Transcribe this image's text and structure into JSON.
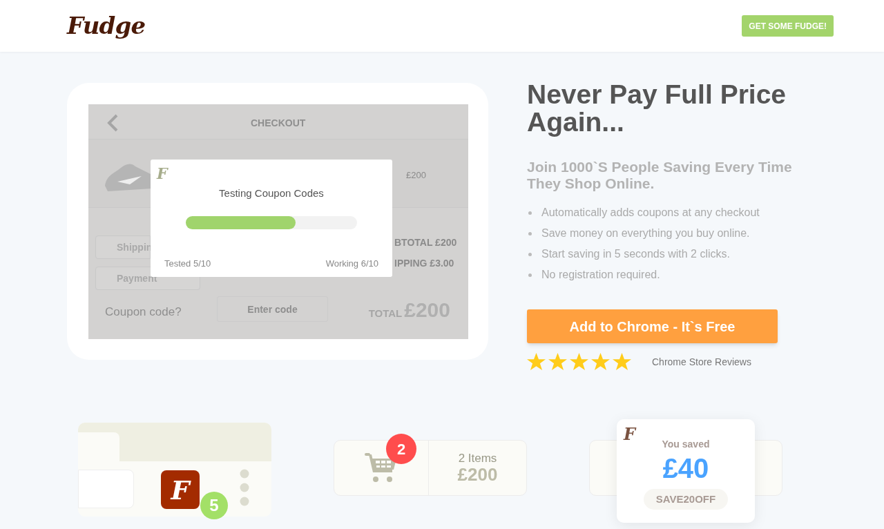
{
  "header": {
    "logo": "Fudge",
    "cta": "GET SOME FUDGE!"
  },
  "checkout_mockup": {
    "title": "CHECKOUT",
    "item_price": "£200",
    "shipping_select": "Shippin",
    "payment_select": "Payment",
    "subtotal": "BTOTAL £200",
    "shipping": "IPPING £3.00",
    "coupon_label": "Coupon code?",
    "coupon_placeholder": "Enter code",
    "total_label": "TOTAL",
    "total_value": "£200",
    "modal": {
      "logo": "F",
      "title": "Testing Coupon Codes",
      "level": 0.64,
      "tested": "Tested 5/10",
      "working": "Working 6/10"
    }
  },
  "hero": {
    "title": "Never Pay Full Price Again...",
    "subtitle": "Join 1000`S People Saving Every Time They Shop Online.",
    "bullets": [
      "Automatically adds coupons at any checkout",
      "Save money on everything you buy online.",
      "Start saving in 5 seconds with 2 clicks.",
      "No registration required."
    ],
    "button": "Add to Chrome - It`s Free",
    "stars": 5,
    "reviews": "Chrome Store Reviews"
  },
  "features": {
    "extension": {
      "icon_letter": "F",
      "badge": "5"
    },
    "cart": {
      "badge": "2",
      "items": "2 Items",
      "total": "£200"
    },
    "saved": {
      "logo": "F",
      "label": "You saved",
      "amount": "£40",
      "code": "SAVE20OFF"
    }
  }
}
